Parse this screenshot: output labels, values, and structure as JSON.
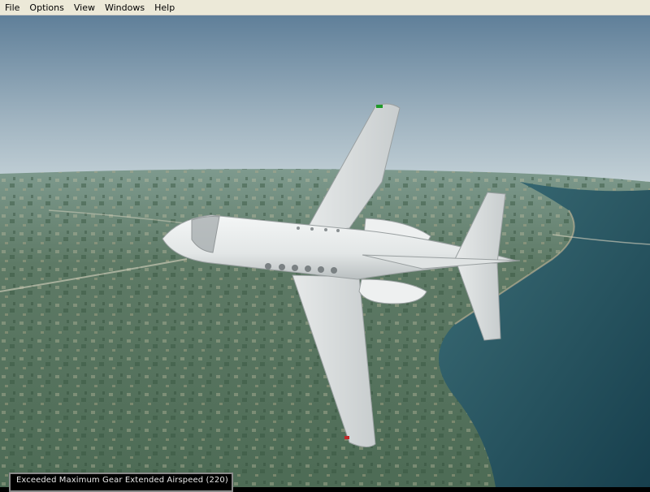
{
  "menu": {
    "file": "File",
    "options": "Options",
    "view": "View",
    "windows": "Windows",
    "help": "Help"
  },
  "status": {
    "message": "Exceeded Maximum Gear Extended Airspeed (220)"
  },
  "colors": {
    "menubar": "#ece9d8",
    "sky_top": "#5f7f99",
    "sky_horizon": "#c8d6dc",
    "water": "#1f4a57",
    "aircraft": "#e9ecec"
  }
}
